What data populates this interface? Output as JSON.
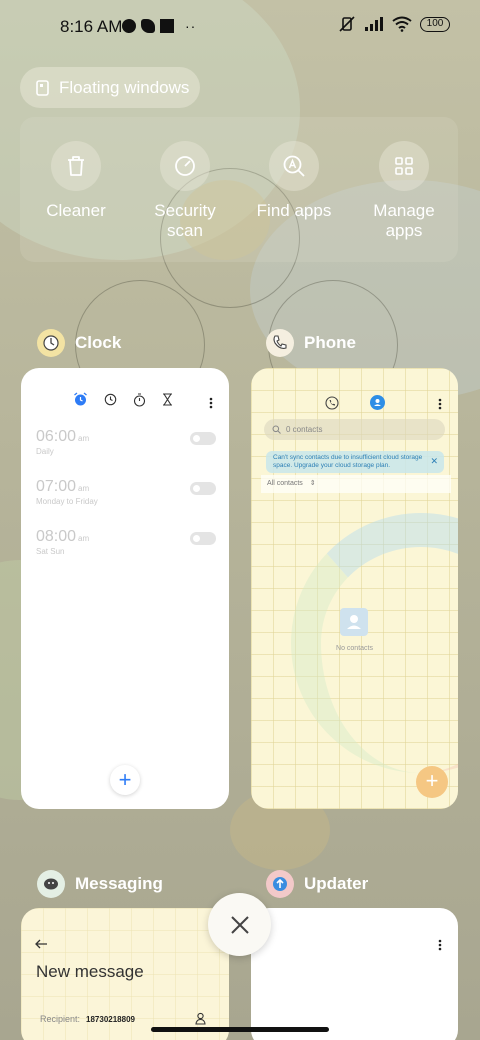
{
  "status_bar": {
    "time": "8:16 AM",
    "battery": "100"
  },
  "floating_windows": {
    "label": "Floating windows"
  },
  "quick_actions": [
    {
      "label": "Cleaner",
      "icon": "trash-icon"
    },
    {
      "label": "Security\nscan",
      "icon": "security-scan-icon"
    },
    {
      "label": "Find apps",
      "icon": "find-apps-icon"
    },
    {
      "label": "Manage\napps",
      "icon": "grid-icon"
    }
  ],
  "apps": {
    "clock": {
      "name": "Clock",
      "alarms": [
        {
          "time": "06:00",
          "ampm": "am",
          "days": "Daily"
        },
        {
          "time": "07:00",
          "ampm": "am",
          "days": "Monday to Friday"
        },
        {
          "time": "08:00",
          "ampm": "am",
          "days": "Sat Sun"
        }
      ],
      "fab": "+"
    },
    "phone": {
      "name": "Phone",
      "search_placeholder": "0 contacts",
      "banner": "Can't sync contacts due to insufficient cloud storage space. Upgrade your cloud storage plan.",
      "filter": "All contacts",
      "empty": "No contacts",
      "fab": "+"
    },
    "messaging": {
      "name": "Messaging",
      "title": "New message",
      "recipient_label": "Recipient:",
      "recipient_value": "18730218809"
    },
    "updater": {
      "name": "Updater"
    }
  },
  "colors": {
    "accent_blue": "#2e7cf6",
    "phone_fab": "#f5c783",
    "wallpaper": "#b7b59c"
  }
}
